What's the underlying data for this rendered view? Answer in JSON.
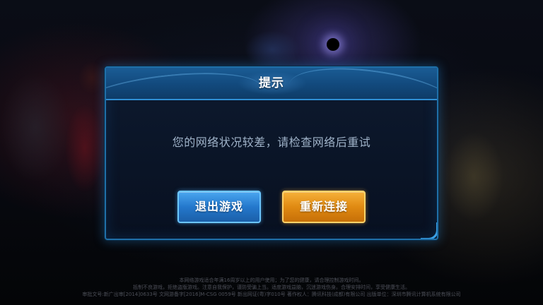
{
  "dialog": {
    "title": "提示",
    "message": "您的网络状况较差，请检查网络后重试",
    "exit_label": "退出游戏",
    "reconnect_label": "重新连接"
  },
  "footer": {
    "line1": "本网络游戏适合年满16周岁以上的用户使用；为了您的健康，请合理控制游戏时间。",
    "line2": "抵制不良游戏，拒绝盗版游戏。注意自我保护，谨防受骗上当。适度游戏益脑，沉迷游戏伤身。合理安排时间，享受健康生活。",
    "line3": "审批文号:新广出审[2014]0633号  文网游备字[2016]M-CSG 0059号  新出网证(粤)字010号  著作权人：腾讯科技(成都)有限公司  出版单位：深圳市腾讯计算机系统有限公司"
  },
  "colors": {
    "dialog_border": "#1f6fa8",
    "title_bar": "#1a5c95",
    "message_text": "#9fb2c8",
    "exit_button": "#2478cc",
    "reconnect_button": "#e08a12"
  }
}
